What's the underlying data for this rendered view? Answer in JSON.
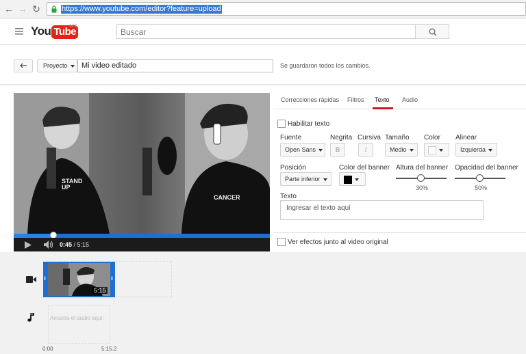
{
  "browser": {
    "url": "https://www.youtube.com/editor?feature=upload"
  },
  "header": {
    "logo_you": "You",
    "logo_tube": "Tube",
    "region": "MX",
    "search_placeholder": "Buscar"
  },
  "project": {
    "menu_label": "Proyecto",
    "title_value": "Mi video editado",
    "status": "Se guardaron todos los cambios."
  },
  "player": {
    "time_current": "0:45",
    "time_separator": " / ",
    "time_total": "5:15",
    "progress_fraction": 0.155,
    "shirt_text_1": "STAND UP",
    "shirt_text_2": "CANCER"
  },
  "tabs": [
    {
      "label": "Correcciones rápidas"
    },
    {
      "label": "Filtros"
    },
    {
      "label": "Texto",
      "active": true
    },
    {
      "label": "Audio"
    }
  ],
  "text_panel": {
    "enable_label": "Habilitar texto",
    "font_label": "Fuente",
    "font_value": "Open Sans",
    "bold_label": "Negrita",
    "bold_icon": "B",
    "italic_label": "Cursiva",
    "italic_icon": "I",
    "size_label": "Tamaño",
    "size_value": "Medio",
    "color_label": "Color",
    "align_label": "Alinear",
    "align_value": "Izquierda",
    "position_label": "Posición",
    "position_value": "Parte inferior",
    "banner_color_label": "Color del banner",
    "banner_height_label": "Altura del banner",
    "banner_height_value": "30%",
    "banner_opacity_label": "Opacidad del banner",
    "banner_opacity_value": "50%",
    "text_label": "Texto",
    "text_placeholder": "Ingresar el texto aquí",
    "side_by_side_label": "Ver efectos junto al video original"
  },
  "timeline": {
    "clip_duration": "5:15",
    "audio_placeholder": "Arrastra el audio aquí.",
    "start_time": "0:00",
    "end_time": "5:15.2"
  },
  "colors": {
    "accent": "#1f6fd0",
    "youtube_red": "#e62117",
    "tab_active": "#cc181e"
  }
}
